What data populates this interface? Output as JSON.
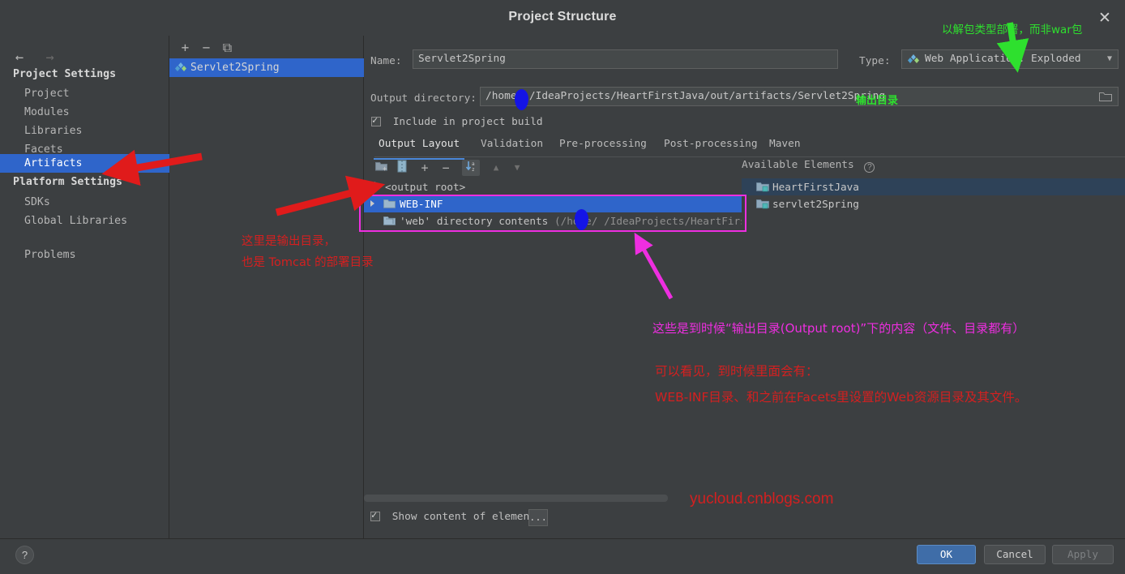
{
  "window": {
    "title": "Project Structure",
    "close_label": "✕"
  },
  "sidebar": {
    "back_label": "←",
    "forward_label": "→",
    "groups": [
      {
        "label": "Project Settings"
      },
      {
        "label": "Platform Settings"
      }
    ],
    "items": [
      {
        "label": "Project"
      },
      {
        "label": "Modules"
      },
      {
        "label": "Libraries"
      },
      {
        "label": "Facets"
      },
      {
        "label": "Artifacts"
      },
      {
        "label": "SDKs"
      },
      {
        "label": "Global Libraries"
      },
      {
        "label": "Problems"
      }
    ],
    "selected": "Artifacts"
  },
  "artifacts_panel": {
    "toolbar": [
      {
        "name": "add-artifact-button",
        "label": "+"
      },
      {
        "name": "remove-artifact-button",
        "label": "−"
      },
      {
        "name": "copy-artifact-button",
        "label": "⧉"
      }
    ],
    "items": [
      {
        "label": "Servlet2Spring",
        "selected": true
      }
    ]
  },
  "main": {
    "name_label": "Name:",
    "name_value": "Servlet2Spring",
    "type_label": "Type:",
    "type_value": "Web Application: Exploded",
    "output_dir_label": "Output directory:",
    "output_dir_value": "/home/    /IdeaProjects/HeartFirstJava/out/artifacts/Servlet2Spring",
    "include_in_build_label": "Include in project build",
    "include_in_build_checked": true,
    "tabs": [
      {
        "label": "Output Layout",
        "active": true
      },
      {
        "label": "Validation",
        "active": false
      },
      {
        "label": "Pre-processing",
        "active": false
      },
      {
        "label": "Post-processing",
        "active": false
      },
      {
        "label": "Maven",
        "active": false
      }
    ],
    "layout_toolbar": [
      {
        "name": "create-directory-button",
        "label": "▭"
      },
      {
        "name": "create-archive-button",
        "label": "‖"
      },
      {
        "name": "add-copy-of-button",
        "label": "+"
      },
      {
        "name": "remove-element-button",
        "label": "−"
      },
      {
        "name": "sort-elements-button",
        "label": "↓"
      },
      {
        "name": "move-up-button",
        "label": "▲"
      },
      {
        "name": "move-down-button",
        "label": "▼"
      }
    ],
    "tree": [
      {
        "label": "<output root>",
        "indent": 0,
        "icon": "output-root-icon",
        "expander": false,
        "selected": false,
        "path": ""
      },
      {
        "label": "WEB-INF",
        "indent": 1,
        "icon": "folder-icon",
        "expander": true,
        "selected": true,
        "path": ""
      },
      {
        "label": "'web' directory contents",
        "indent": 1,
        "icon": "folder-copy-icon",
        "expander": false,
        "selected": false,
        "path": "(/home/    /IdeaProjects/HeartFirstJava"
      }
    ],
    "available_elements_title": "Available Elements",
    "available_elements_help": "?",
    "available": [
      {
        "label": "HeartFirstJava",
        "highlight": true
      },
      {
        "label": "servlet2Spring",
        "highlight": false
      }
    ],
    "show_content_label": "Show content of elements",
    "show_content_checked": true,
    "dots_button_label": "..."
  },
  "bottom": {
    "help_label": "?",
    "buttons": [
      {
        "label": "OK",
        "style": "primary"
      },
      {
        "label": "Cancel",
        "style": "normal"
      },
      {
        "label": "Apply",
        "style": "disabled"
      }
    ]
  },
  "annotations": {
    "green_top": "以解包类型部署，而非war包",
    "green_output_dir": "输出目录",
    "red_left_1": "这里是输出目录，",
    "red_left_2": "也是 Tomcat 的部署目录",
    "magenta_main": "这些是到时候“输出目录(Output root)”下的内容（文件、目录都有）",
    "red_main_1": "可以看见，到时候里面会有：",
    "red_main_2": "WEB-INF目录、和之前在Facets里设置的Web资源目录及其文件。",
    "watermark": "yucloud.cnblogs.com"
  },
  "colors": {
    "selection_blue": "#2f65ca",
    "annotation_red": "#d32020",
    "annotation_green": "#2ee02e",
    "annotation_magenta": "#ee2ee0",
    "window_bg": "#3c3f41"
  }
}
